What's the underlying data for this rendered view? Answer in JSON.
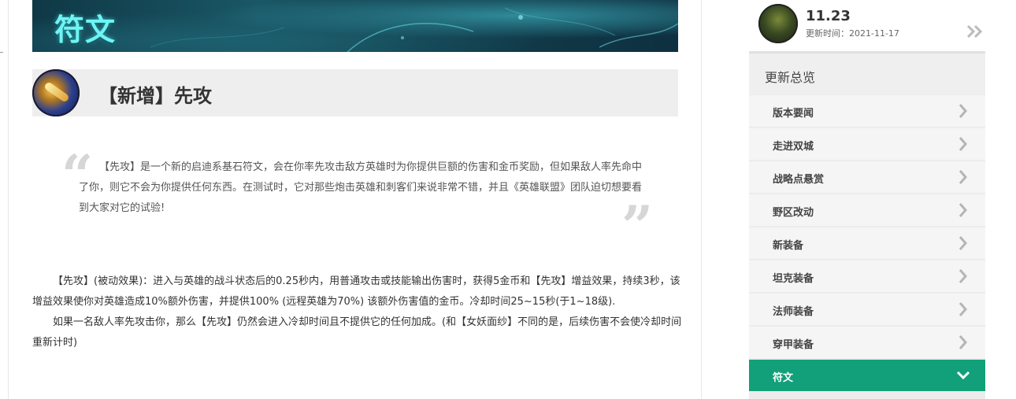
{
  "banner": {
    "title": "符文"
  },
  "section": {
    "title": "【新增】先攻"
  },
  "quote": {
    "text": "【先攻】是一个新的启迪系基石符文，会在你率先攻击敌方英雄时为你提供巨额的伤害和金币奖励，但如果敌人率先命中了你，则它不会为你提供任何东西。在测试时，它对那些炮击英雄和刺客们来说非常不错，并且《英雄联盟》团队迫切想要看到大家对它的试验!"
  },
  "body": {
    "p1": "【先攻】(被动效果)：进入与英雄的战斗状态后的0.25秒内，用普通攻击或技能输出伤害时，获得5金币和【先攻】增益效果，持续3秒，该增益效果使你对英雄造成10%额外伤害，并提供100% (远程英雄为70%) 该额外伤害值的金币。冷却时间25~15秒(于1~18级).",
    "p2": "如果一名敌人率先攻击你，那么【先攻】仍然会进入冷却时间且不提供它的任何加成。(和【女妖面纱】不同的是，后续伤害不会使冷却时间重新计时)"
  },
  "version": {
    "number": "11.23",
    "date": "更新时间：2021-11-17"
  },
  "nav": {
    "heading": "更新总览",
    "items": [
      "版本要闻",
      "走进双城",
      "战略点悬赏",
      "野区改动",
      "新装备",
      "坦克装备",
      "法师装备",
      "穿甲装备",
      "符文"
    ],
    "active_index": 8,
    "accent": "#12a07a"
  }
}
